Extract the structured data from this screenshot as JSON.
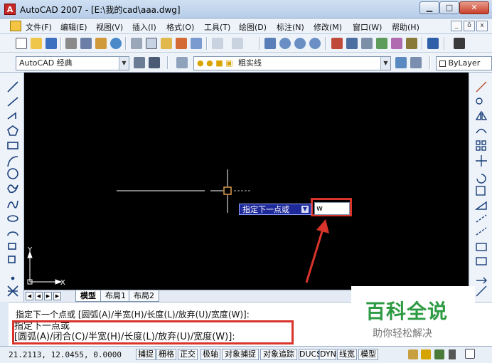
{
  "window": {
    "title": "AutoCAD 2007 - [E:\\我的cad\\aaa.dwg]",
    "app_icon_letter": "A",
    "min_glyph": "▁",
    "max_glyph": "□",
    "close_glyph": "✕"
  },
  "menu": {
    "items": [
      "文件(F)",
      "编辑(E)",
      "视图(V)",
      "插入(I)",
      "格式(O)",
      "工具(T)",
      "绘图(D)",
      "标注(N)",
      "修改(M)",
      "窗口(W)",
      "帮助(H)"
    ],
    "doc_min": "_",
    "doc_restore": "ō",
    "doc_close": "x"
  },
  "toolbar": {
    "workspace": "AutoCAD 经典",
    "layer_name": "粗实线",
    "color_value": "ByLayer",
    "text_style": "Sta"
  },
  "layout_tabs": [
    "模型",
    "布局1",
    "布局2"
  ],
  "dynamic_input": {
    "prompt": "指定下一点或",
    "value": "w"
  },
  "command": {
    "line1": "指定下一个点或 [圆弧(A)/半宽(H)/长度(L)/放弃(U)/宽度(W)]:",
    "line2": "指定下一点或",
    "line3": "[圆弧(A)/闭合(C)/半宽(H)/长度(L)/放弃(U)/宽度(W)]:"
  },
  "watermark": {
    "title": "百科全说",
    "subtitle": "助你轻松解决"
  },
  "status": {
    "coordinates": "21.2113, 12.0455, 0.0000",
    "buttons": [
      "捕捉",
      "栅格",
      "正交",
      "极轴",
      "对象捕捉",
      "对象追踪",
      "DUCS",
      "DYN",
      "线宽",
      "模型"
    ]
  },
  "colors": {
    "highlight": "#d9342b",
    "watermark_green": "#2e9b44",
    "canvas": "#000000"
  }
}
